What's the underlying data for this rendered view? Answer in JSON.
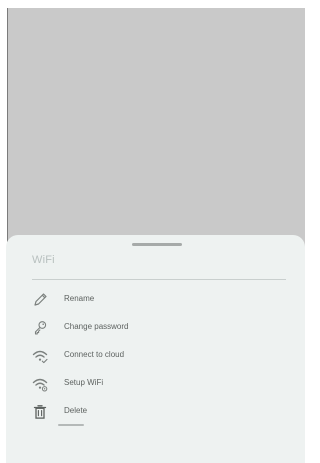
{
  "sheet": {
    "title": "WiFi",
    "items": [
      {
        "label": "Rename",
        "icon": "pencil-icon"
      },
      {
        "label": "Change password",
        "icon": "key-icon"
      },
      {
        "label": "Connect to cloud",
        "icon": "wifi-check-icon"
      },
      {
        "label": "Setup WiFi",
        "icon": "wifi-settings-icon"
      },
      {
        "label": "Delete",
        "icon": "trash-icon"
      }
    ]
  },
  "colors": {
    "overlay": "#c9c9c9",
    "sheet_background": "#eef2f1",
    "text": "#5d6260",
    "muted_text": "#b8c0bf",
    "icon": "#7b807e"
  }
}
